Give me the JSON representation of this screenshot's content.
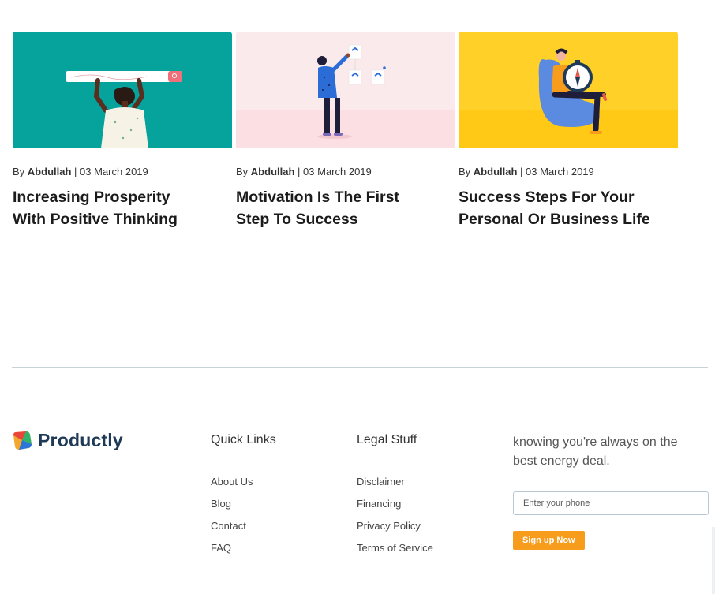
{
  "posts": [
    {
      "by": "By",
      "author": "Abdullah",
      "separator": "|",
      "date": "03 March 2019",
      "title_line1": "Increasing Prosperity",
      "title_line2": "With Positive Thinking"
    },
    {
      "by": "By",
      "author": "Abdullah",
      "separator": "|",
      "date": "03 March 2019",
      "title_line1": "Motivation Is The First",
      "title_line2": "Step To Success"
    },
    {
      "by": "By",
      "author": "Abdullah",
      "separator": "|",
      "date": "03 March 2019",
      "title_line1": "Success Steps For Your",
      "title_line2": "Personal Or Business Life"
    }
  ],
  "footer": {
    "brand": "Productly",
    "quick_links": {
      "heading": "Quick Links",
      "items": [
        "About Us",
        "Blog",
        "Contact",
        "FAQ"
      ]
    },
    "legal": {
      "heading": "Legal Stuff",
      "items": [
        "Disclaimer",
        "Financing",
        "Privacy Policy",
        "Terms of Service"
      ]
    },
    "newsletter": {
      "text_line1": "knowing you're always on the",
      "text_line2": "best energy deal.",
      "placeholder": "Enter your phone",
      "button": "Sign up Now"
    }
  },
  "colors": {
    "teal": "#05a39c",
    "pink": "#fbeaec",
    "yellow": "#ffd028",
    "accent": "#f89c1c",
    "brand": "#1e3a56"
  }
}
